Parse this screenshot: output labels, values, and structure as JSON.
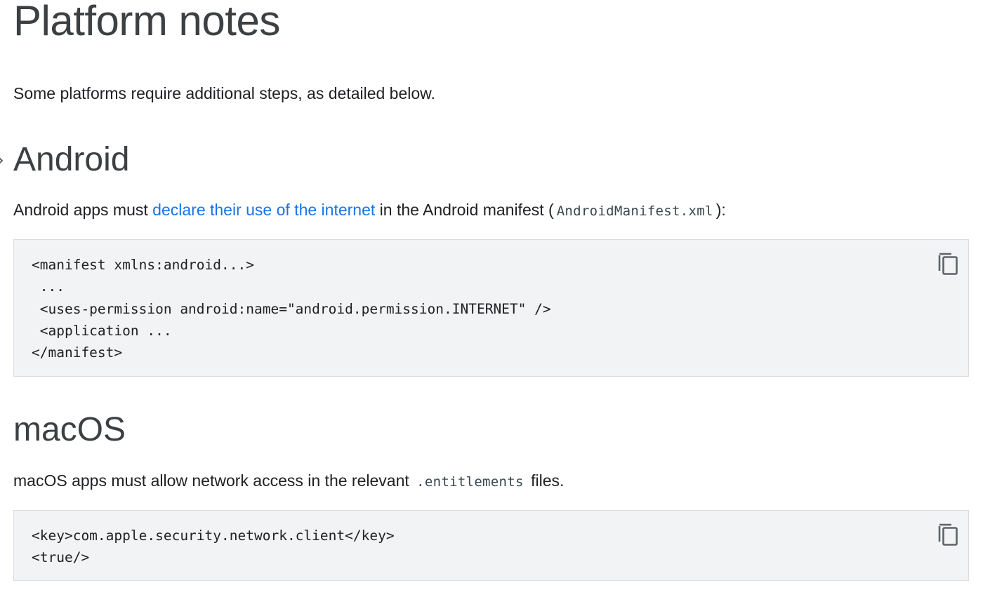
{
  "page": {
    "title": "Platform notes",
    "intro": "Some platforms require additional steps, as detailed below."
  },
  "android": {
    "heading": "Android",
    "text_before_link": "Android apps must ",
    "link_text": "declare their use of the internet",
    "text_after_link": " in the Android manifest (",
    "code_inline": "AndroidManifest.xml",
    "text_end": "):",
    "code_lines": [
      "<manifest xmlns:android...>",
      " ...",
      " <uses-permission android:name=\"android.permission.INTERNET\" />",
      " <application ...",
      "</manifest>"
    ],
    "copy_icon": "copy-icon"
  },
  "macos": {
    "heading": "macOS",
    "text_before_code": "macOS apps must allow network access in the relevant ",
    "code_inline": ".entitlements",
    "text_after_code": " files.",
    "code_lines": [
      "<key>com.apple.security.network.client</key>",
      "<true/>"
    ],
    "copy_icon": "copy-icon"
  },
  "colors": {
    "link": "#1a73e8",
    "heading": "#3c4043",
    "code_background": "#f1f3f4"
  }
}
